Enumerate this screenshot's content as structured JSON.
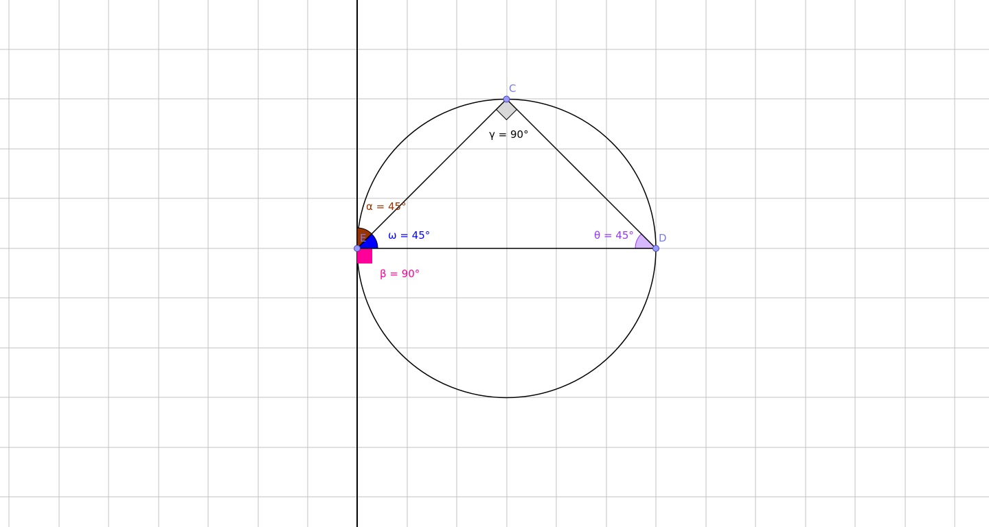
{
  "colors": {
    "grid": "#c0c0c0",
    "axis": "#000000",
    "circle": "#000000",
    "point_fill": "#9999ff",
    "point_stroke": "#4444aa",
    "point_label": "#7b7bea",
    "alpha": "#993300",
    "omega": "#0000ff",
    "beta": "#ff0099",
    "theta": "#9933ff",
    "theta_fill": "#d6b8ff",
    "gamma": "#000000",
    "gamma_fill": "#d8d8d8"
  },
  "points": {
    "C": "C",
    "D": "D",
    "E": "E"
  },
  "angles": {
    "alpha": "α = 45°",
    "omega": "ω = 45°",
    "beta": "β = 90°",
    "theta": "θ = 45°",
    "gamma": "γ = 90°"
  }
}
